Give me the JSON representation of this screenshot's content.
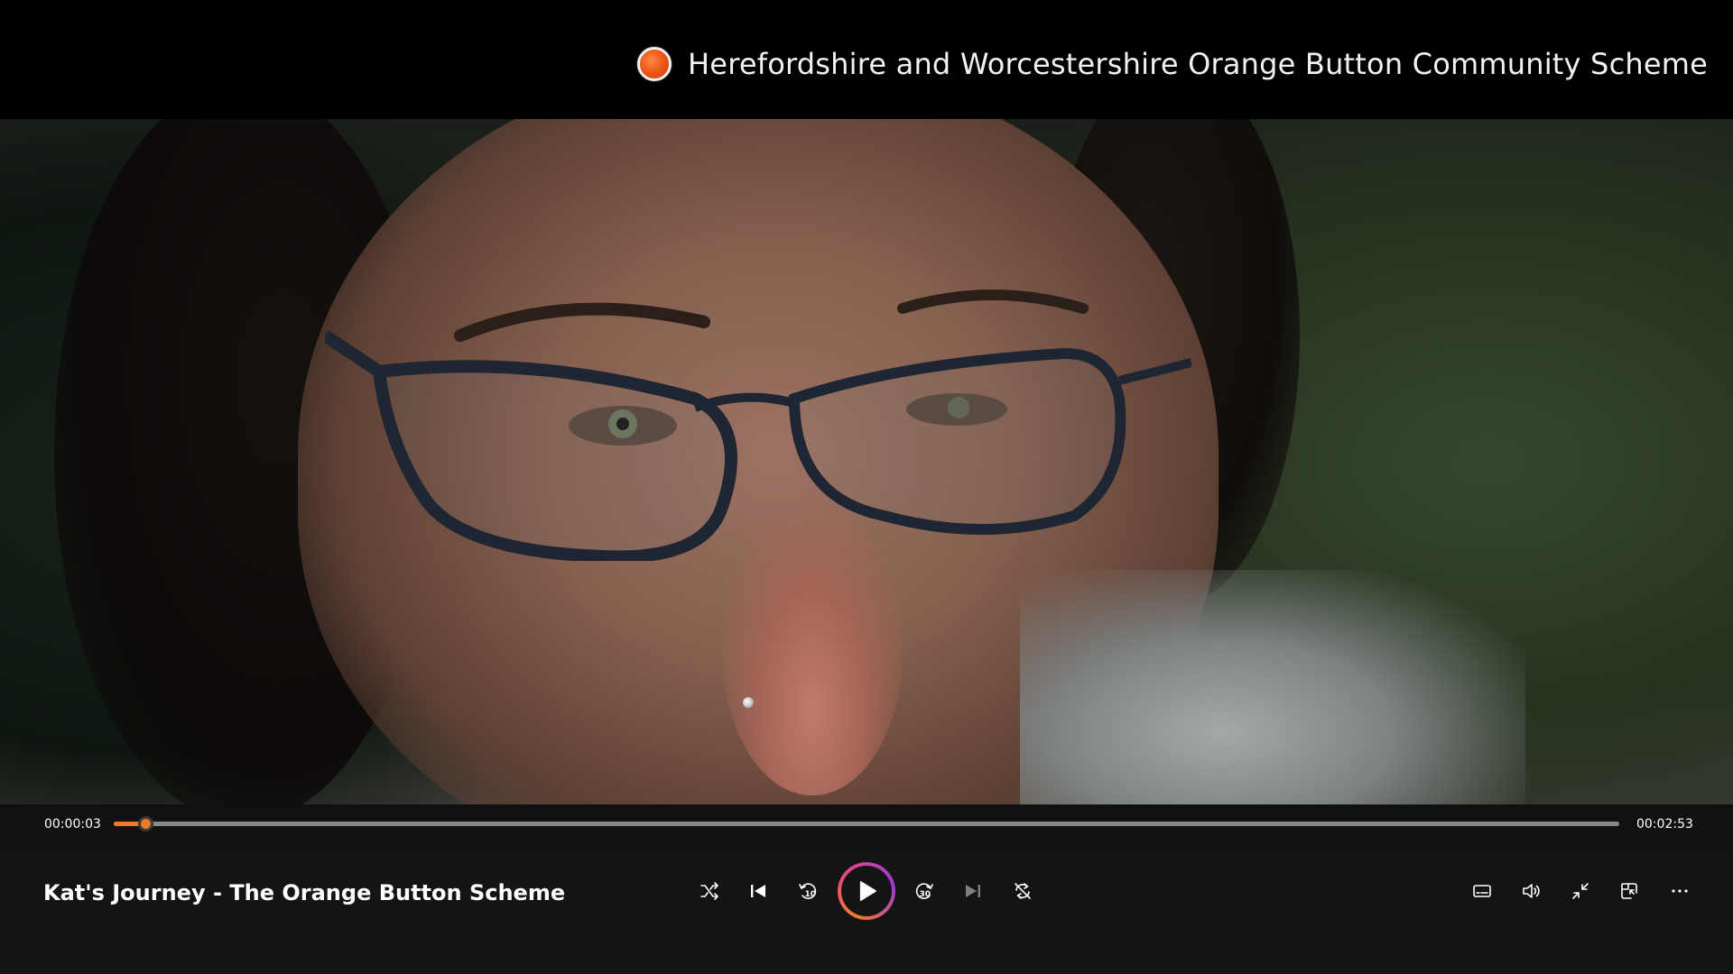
{
  "banner": {
    "title": "Herefordshire and Worcestershire Orange Button Community Scheme",
    "logo_color": "#f05a1a"
  },
  "video": {
    "current_time": "00:00:03",
    "total_time": "00:02:53",
    "progress_percent": 2.1,
    "accent_color": "#f07a2a"
  },
  "media": {
    "title": "Kat's Journey - The Orange Button Scheme"
  },
  "controls": {
    "shuffle": "shuffle-icon",
    "previous": "previous-track-icon",
    "rewind": "rewind-10-icon",
    "rewind_label": "10",
    "play": "play-icon",
    "forward": "forward-30-icon",
    "forward_label": "30",
    "next": "next-track-icon",
    "repeat": "repeat-icon",
    "subtitles": "subtitles-icon",
    "volume": "volume-icon",
    "exit_fullscreen": "exit-fullscreen-icon",
    "mini_player": "mini-player-icon",
    "more": "more-options-icon"
  }
}
